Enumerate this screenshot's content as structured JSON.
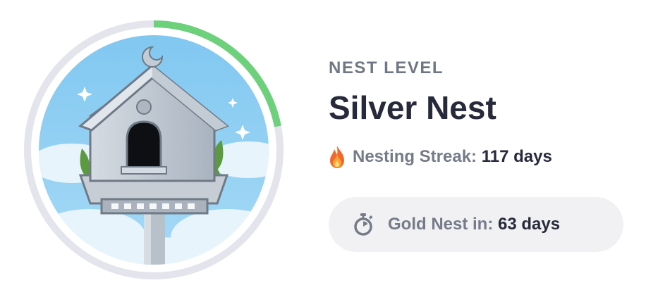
{
  "nest": {
    "level_label": "NEST LEVEL",
    "level_name": "Silver Nest",
    "progress": 0.22
  },
  "streak": {
    "icon": "flame-icon",
    "label": "Nesting Streak:",
    "value": "117 days"
  },
  "next": {
    "icon": "stopwatch-icon",
    "label": "Gold Nest in:",
    "value": "63 days"
  },
  "colors": {
    "progress": "#6cd17a",
    "track": "#e3e4ec",
    "sky": "#8ccdf2",
    "title": "#272a3b",
    "muted": "#757b88",
    "pill": "#f1f1f3"
  }
}
